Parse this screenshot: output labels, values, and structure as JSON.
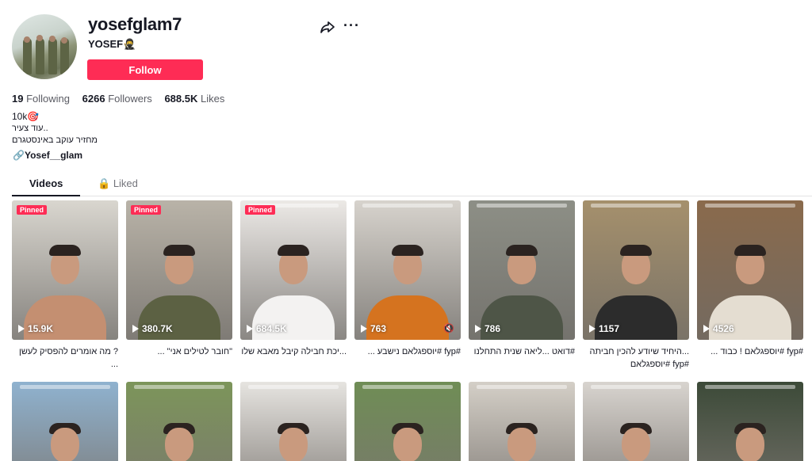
{
  "profile": {
    "username": "yosefglam7",
    "nickname": "YOSEF🥷",
    "follow_label": "Follow",
    "stats": {
      "following_count": "19",
      "following_label": "Following",
      "followers_count": "6266",
      "followers_label": "Followers",
      "likes_count": "688.5K",
      "likes_label": "Likes"
    },
    "bio": [
      "10k🎯",
      "עוד צעיר..",
      "מחזיר עוקב באינסטגרם"
    ],
    "link": "Yosef__glam"
  },
  "tabs": {
    "videos": "Videos",
    "liked": "Liked"
  },
  "videos": [
    {
      "pinned": "Pinned",
      "views": "15.9K",
      "caption": "? מה אומרים להפסיק לעשן ...",
      "bg": "#d9d6cf",
      "shirt": "#c48f71"
    },
    {
      "pinned": "Pinned",
      "views": "380.7K",
      "caption": "\"חובר לטילים אני\" ...",
      "bg": "#b9b3a8",
      "shirt": "#5c6143"
    },
    {
      "pinned": "Pinned",
      "views": "684.5K",
      "caption": "...יכת חבילה קיבל מאבא שלו",
      "bg": "#ece9e6",
      "shirt": "#f3f2f1"
    },
    {
      "pinned": "",
      "views": "763",
      "caption": "#fyp #יוספגלאם נישבע ...",
      "bg": "#d7d3cd",
      "shirt": "#d5731f",
      "muted": true
    },
    {
      "pinned": "",
      "views": "786",
      "caption": "#דואט ...ליאה שנית התחלנו",
      "bg": "#8d8f86",
      "shirt": "#4e5547"
    },
    {
      "pinned": "",
      "views": "1157",
      "caption": "...היחיד שיודע להכין חביתה #fyp #יוספגלאם",
      "bg": "#a5906c",
      "shirt": "#2c2c2c"
    },
    {
      "pinned": "",
      "views": "4526",
      "caption": "#fyp #יוספגלאם ! כבוד ...",
      "bg": "#8a6a4c",
      "shirt": "#e4ddd1"
    }
  ],
  "row2": [
    {
      "bg": "#8fb2cf"
    },
    {
      "bg": "#7c955a"
    },
    {
      "bg": "#e6e4e0"
    },
    {
      "bg": "#6f8d55"
    },
    {
      "bg": "#d4cfc7"
    },
    {
      "bg": "#d8d4cf"
    },
    {
      "bg": "#3c4a38"
    }
  ]
}
